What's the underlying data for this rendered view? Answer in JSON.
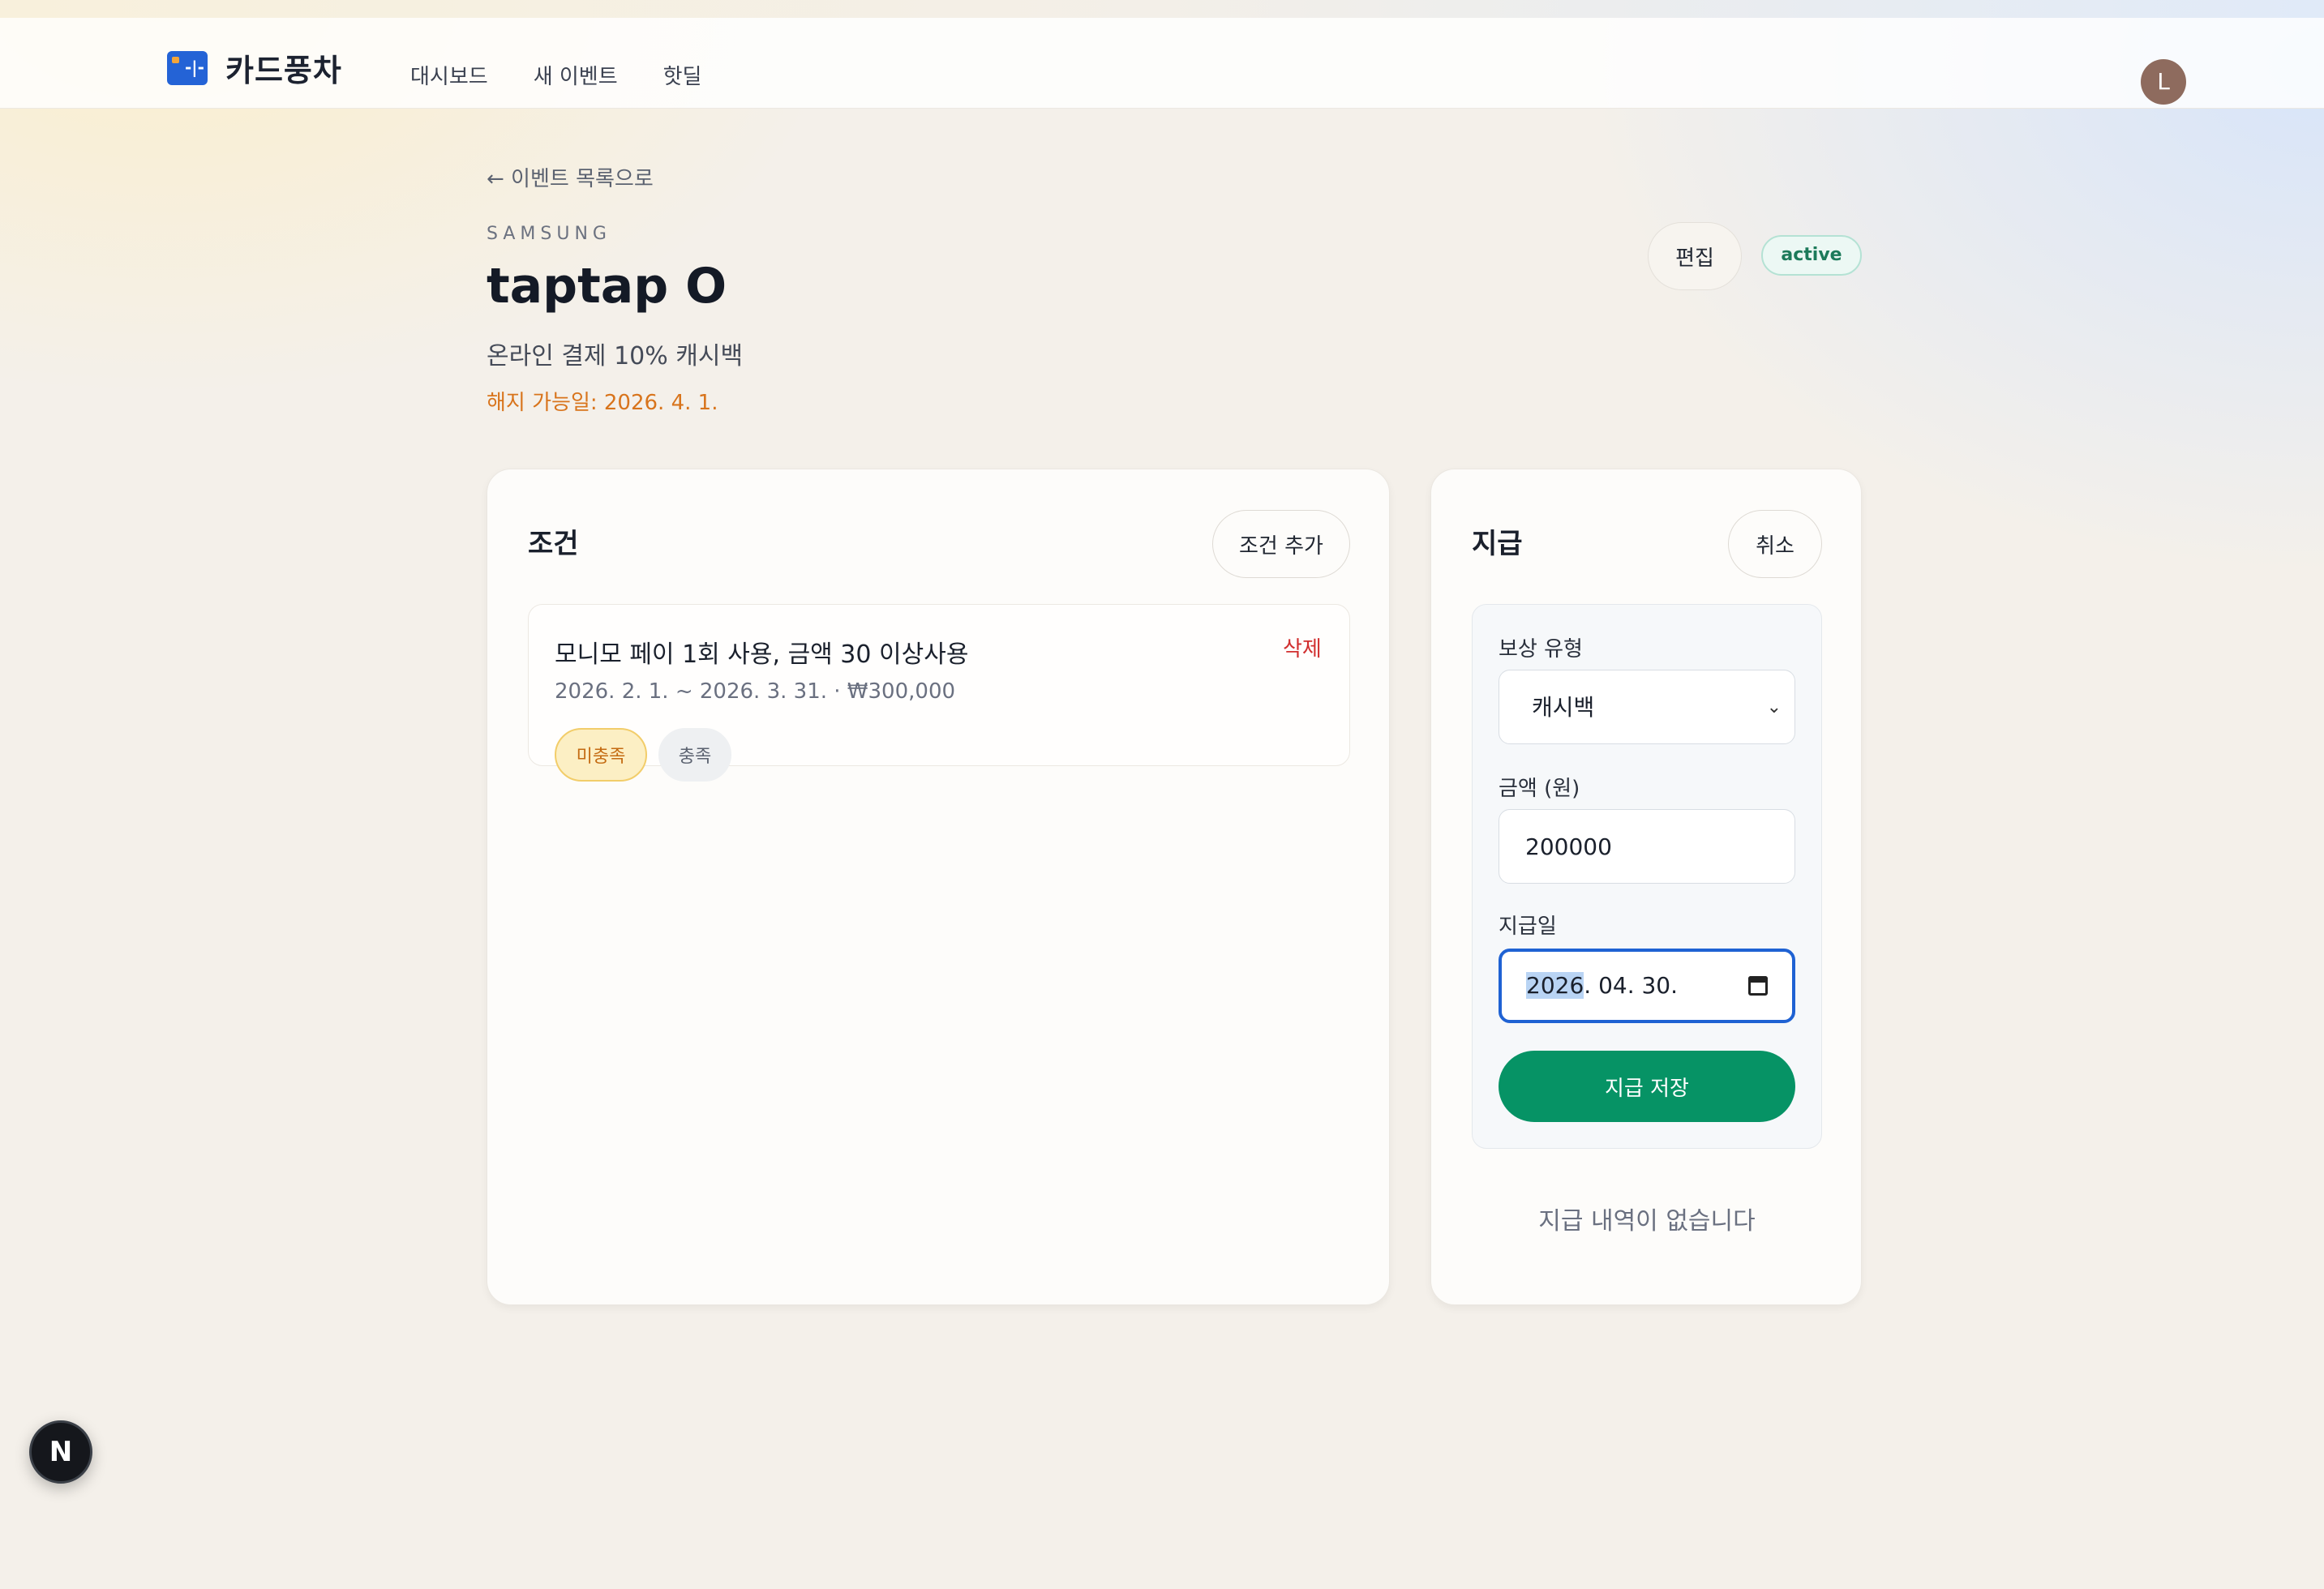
{
  "header": {
    "brand_name": "카드풍차",
    "brand_icon": "credit-card-icon",
    "nav": [
      "대시보드",
      "새 이벤트",
      "핫딜"
    ],
    "avatar_initial": "L"
  },
  "page": {
    "back_link": "← 이벤트 목록으로",
    "brand": "SAMSUNG",
    "title": "taptap O",
    "description": "온라인 결제 10% 캐시백",
    "cancel_date": "해지 가능일: 2026. 4. 1.",
    "edit_label": "편집",
    "status": "active"
  },
  "conditions": {
    "title": "조건",
    "add_label": "조건 추가",
    "items": [
      {
        "name": "모니모 페이 1회 사용, 금액 30 이상사용",
        "delete_label": "삭제",
        "meta": "2026. 2. 1. ~ 2026. 3. 31. · ₩300,000",
        "chip_unmet": "미충족",
        "chip_met": "충족"
      }
    ]
  },
  "payment": {
    "title": "지급",
    "cancel_label": "취소",
    "reward_type_label": "보상 유형",
    "reward_type_value": "캐시백",
    "amount_label": "금액 (원)",
    "amount_value": "200000",
    "date_label": "지급일",
    "date_year": "2026",
    "date_rest": ". 04. 30.",
    "save_label": "지급 저장",
    "empty_note": "지급 내역이 없습니다"
  },
  "dev_badge": "N",
  "colors": {
    "accent": "#1f62d3",
    "primary_green": "#069365",
    "warning_orange": "#d8741c",
    "danger_red": "#d12f2f",
    "brand_blue": "#2463d6"
  }
}
